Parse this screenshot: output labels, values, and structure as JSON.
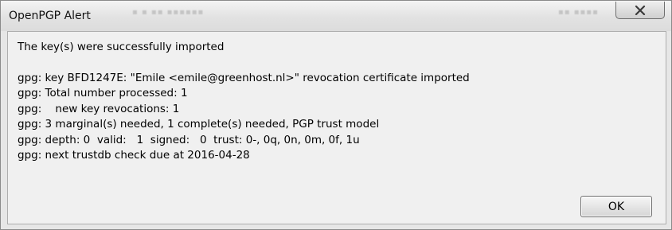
{
  "window": {
    "title": "OpenPGP Alert"
  },
  "message": {
    "headline": "The key(s) were successfully imported",
    "lines": [
      "gpg: key BFD1247E: \"Emile <emile@greenhost.nl>\" revocation certificate imported",
      "gpg: Total number processed: 1",
      "gpg:    new key revocations: 1",
      "gpg: 3 marginal(s) needed, 1 complete(s) needed, PGP trust model",
      "gpg: depth: 0  valid:   1  signed:   0  trust: 0-, 0q, 0n, 0m, 0f, 1u",
      "gpg: next trustdb check due at 2016-04-28"
    ]
  },
  "buttons": {
    "ok_label": "OK",
    "close_icon": "close-x-icon"
  }
}
